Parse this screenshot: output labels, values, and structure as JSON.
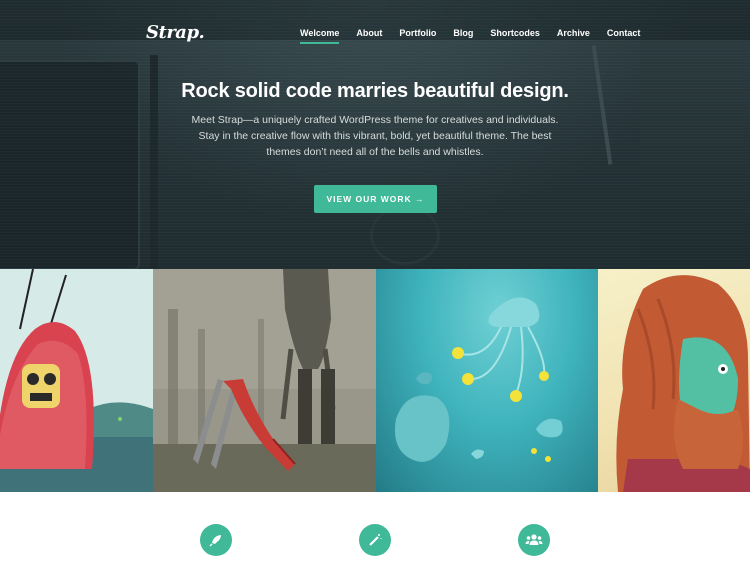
{
  "header": {
    "logo": "Strap.",
    "nav": [
      {
        "label": "Welcome",
        "active": true
      },
      {
        "label": "About"
      },
      {
        "label": "Portfolio"
      },
      {
        "label": "Blog"
      },
      {
        "label": "Shortcodes"
      },
      {
        "label": "Archive"
      },
      {
        "label": "Contact"
      }
    ]
  },
  "hero": {
    "headline": "Rock solid code marries beautiful design.",
    "intro": "Meet Strap—a uniquely crafted WordPress theme for creatives and individuals. Stay in the creative flow with this vibrant, bold, yet beautiful theme. The best themes don’t need all of the bells and whistles.",
    "cta_label": "VIEW OUR WORK →"
  },
  "gallery": {
    "tiles": [
      {
        "subject": "red furry monster with mask by the sea"
      },
      {
        "subject": "red slide in a foggy forest with giant figure"
      },
      {
        "subject": "jellyfish underwater"
      },
      {
        "subject": "bearded red-haired character"
      }
    ]
  },
  "features": {
    "icons": [
      "rocket-icon",
      "magic-wand-icon",
      "users-icon"
    ]
  },
  "colors": {
    "accent": "#3fb997",
    "hero_bg": "#253338",
    "nav_text": "#ffffff"
  }
}
